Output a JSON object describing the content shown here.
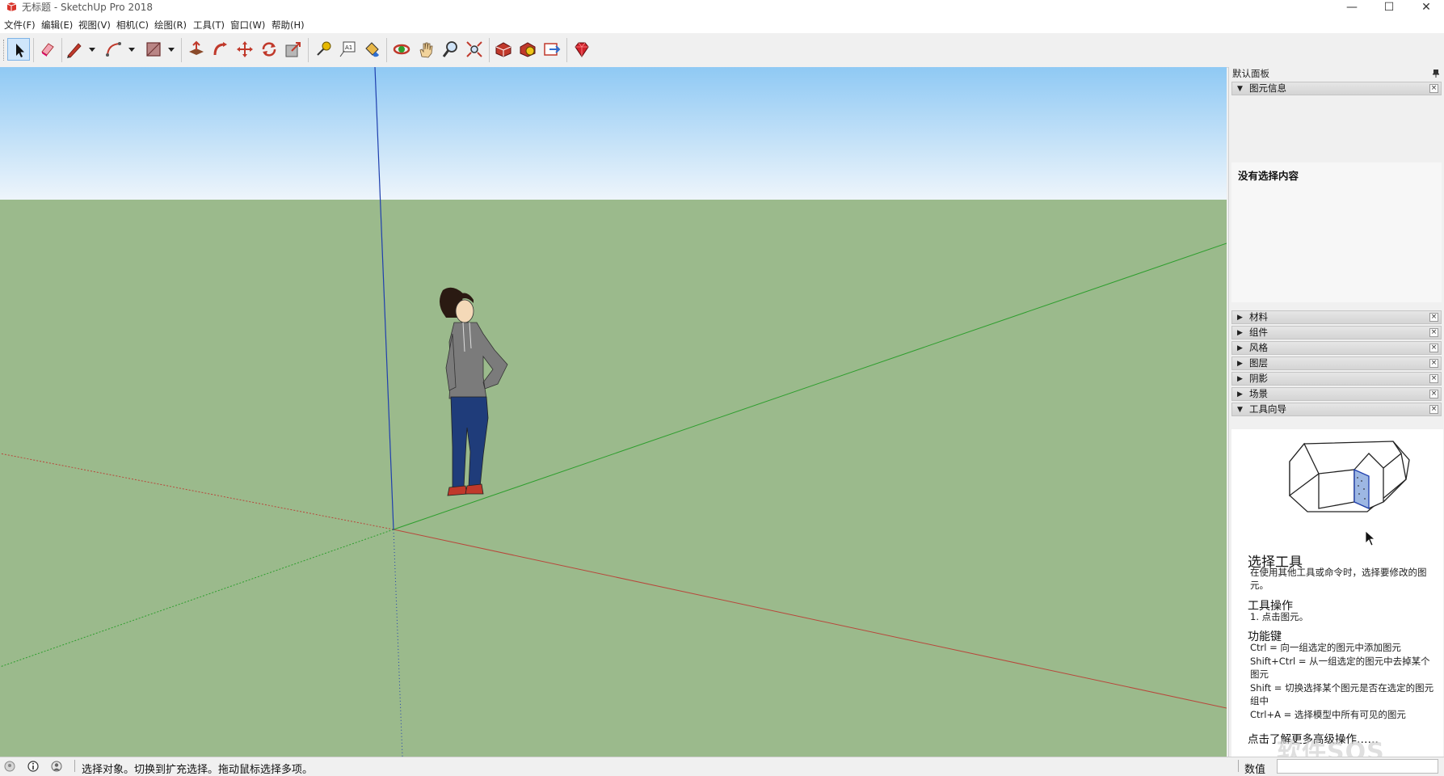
{
  "window": {
    "title": "无标题 - SketchUp Pro 2018",
    "controls": {
      "minimize": "—",
      "maximize": "☐",
      "close": "✕"
    }
  },
  "menu": [
    "文件(F)",
    "编辑(E)",
    "视图(V)",
    "相机(C)",
    "绘图(R)",
    "工具(T)",
    "窗口(W)",
    "帮助(H)"
  ],
  "toolbar": {
    "tools": [
      "select",
      "eraser",
      "line",
      "arc",
      "rectangle",
      "push-pull",
      "follow-me",
      "move",
      "rotate",
      "scale",
      "tape-measure",
      "text",
      "paint-bucket",
      "orbit",
      "pan",
      "zoom",
      "zoom-extents",
      "3d-warehouse",
      "extension-warehouse",
      "send-to-layout",
      "extension-manager"
    ],
    "active_tool": "select"
  },
  "panel": {
    "tray_title": "默认面板",
    "entity_info": {
      "label": "图元信息",
      "content": "没有选择内容"
    },
    "sections": [
      "材料",
      "组件",
      "风格",
      "图层",
      "阴影",
      "场景",
      "工具向导"
    ],
    "instructor": {
      "title": "选择工具",
      "description": "在使用其他工具或命令时，选择要修改的图元。",
      "ops_heading": "工具操作",
      "ops_step": "1. 点击图元。",
      "keys_heading": "功能键",
      "keys": [
        "Ctrl = 向一组选定的图元中添加图元",
        "Shift+Ctrl = 从一组选定的图元中去掉某个图元",
        "Shift = 切换选择某个图元是否在选定的图元组中",
        "Ctrl+A = 选择模型中所有可见的图元"
      ],
      "more_link": "点击了解更多高级操作……"
    }
  },
  "status": {
    "text": "选择对象。切换到扩充选择。拖动鼠标选择多项。",
    "measure_label": "数值",
    "measure_value": ""
  },
  "watermark": "软件SOS",
  "colors": {
    "sky_top": "#8fc9f4",
    "sky_bottom": "#eef5fb",
    "ground": "#9bba8c",
    "axis_red": "#c0392b",
    "axis_green": "#2e9e2e",
    "axis_blue": "#1f3fae"
  }
}
